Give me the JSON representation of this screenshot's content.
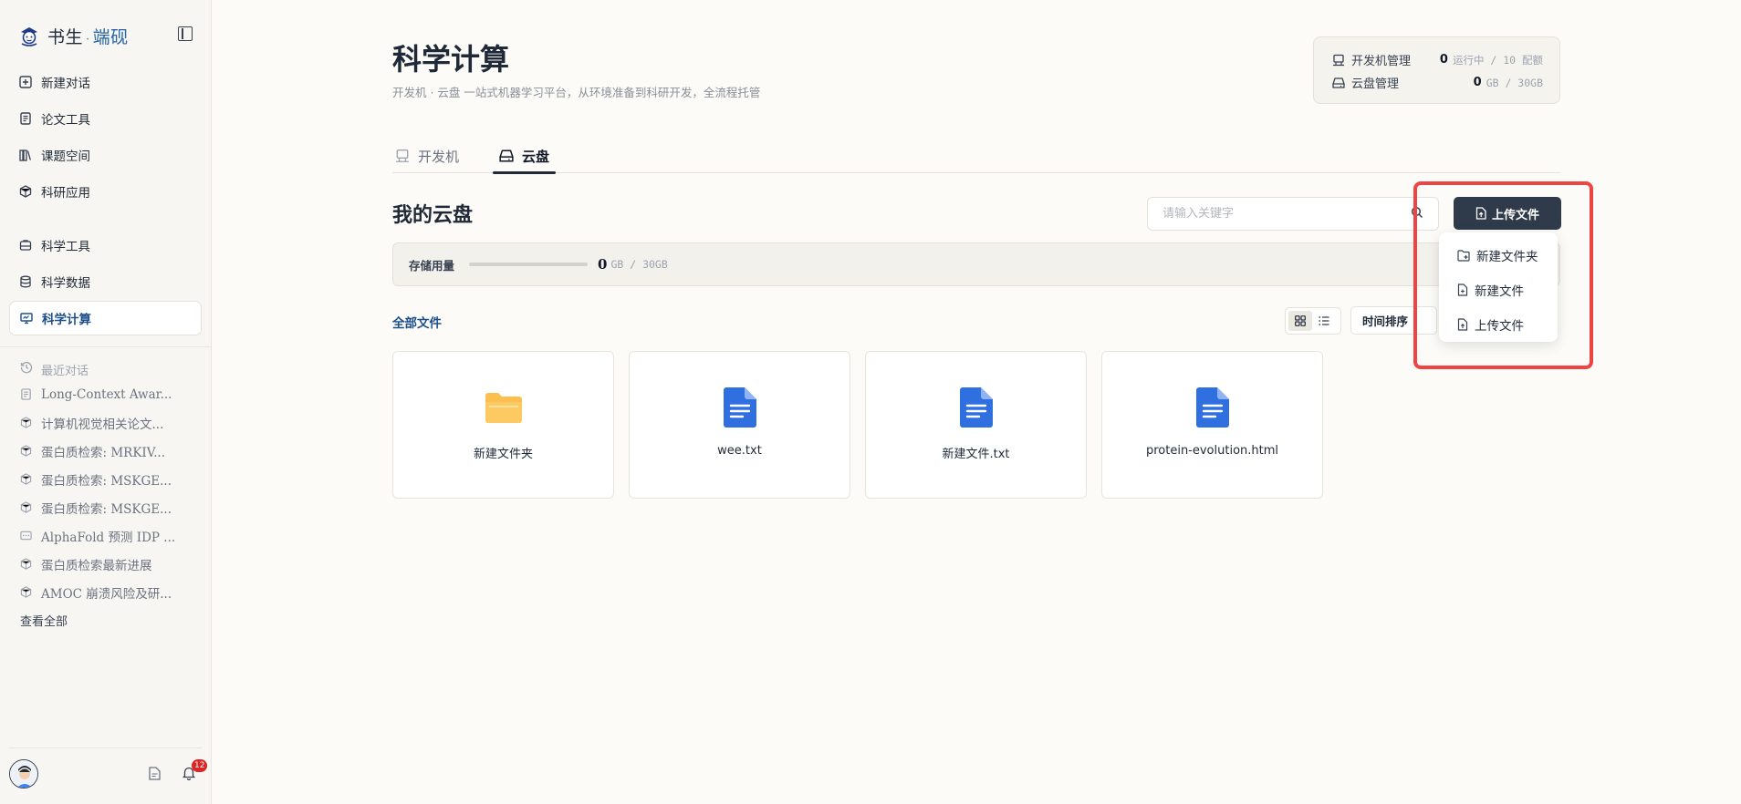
{
  "brand": {
    "name_main": "书生",
    "sep": "·",
    "name_accent": "端砚"
  },
  "sidebar": {
    "nav": [
      {
        "label": "新建对话",
        "icon": "plus-square-icon"
      },
      {
        "label": "论文工具",
        "icon": "document-icon"
      },
      {
        "label": "课题空间",
        "icon": "books-icon"
      },
      {
        "label": "科研应用",
        "icon": "cube-icon"
      }
    ],
    "nav2": [
      {
        "label": "科学工具",
        "icon": "toolbox-icon"
      },
      {
        "label": "科学数据",
        "icon": "database-icon"
      },
      {
        "label": "科学计算",
        "icon": "monitor-icon",
        "active": true
      }
    ],
    "recent_title": "最近对话",
    "recent": [
      {
        "label": "Long-Context Awar...",
        "icon": "document-icon"
      },
      {
        "label": "计算机视觉相关论文...",
        "icon": "cube-icon"
      },
      {
        "label": "蛋白质检索: MRKIV...",
        "icon": "cube-icon"
      },
      {
        "label": "蛋白质检索: MSKGE...",
        "icon": "cube-icon"
      },
      {
        "label": "蛋白质检索: MSKGE...",
        "icon": "cube-icon"
      },
      {
        "label": "AlphaFold 预测 IDP ...",
        "icon": "chat-icon"
      },
      {
        "label": "蛋白质检索最新进展",
        "icon": "cube-icon"
      },
      {
        "label": "AMOC 崩溃风险及研...",
        "icon": "cube-icon"
      }
    ],
    "view_all": "查看全部",
    "notification_count": "12"
  },
  "page": {
    "title": "科学计算",
    "subtitle": "开发机 · 云盘 一站式机器学习平台，从环境准备到科研开发，全流程托管"
  },
  "quota": {
    "dev": {
      "label": "开发机管理",
      "num": "0",
      "unit": "运行中 / 10 配额"
    },
    "disk": {
      "label": "云盘管理",
      "num": "0",
      "unit": "GB / 30GB"
    }
  },
  "tabs": [
    {
      "label": "开发机"
    },
    {
      "label": "云盘"
    }
  ],
  "drive": {
    "title": "我的云盘",
    "search_placeholder": "请输入关键字",
    "upload_label": "上传文件",
    "storage_label": "存储用量",
    "storage_used": "0",
    "storage_unit": "GB / 30GB",
    "storage_fraction": 0,
    "all_files": "全部文件",
    "sort_label": "时间排序",
    "files": [
      {
        "name": "新建文件夹",
        "type": "folder"
      },
      {
        "name": "wee.txt",
        "type": "file"
      },
      {
        "name": "新建文件.txt",
        "type": "file"
      },
      {
        "name": "protein-evolution.html",
        "type": "file"
      }
    ]
  },
  "dropdown": [
    {
      "label": "新建文件夹",
      "icon": "folder-plus-icon"
    },
    {
      "label": "新建文件",
      "icon": "file-plus-icon"
    },
    {
      "label": "上传文件",
      "icon": "file-upload-icon"
    }
  ],
  "colors": {
    "accent": "#1d4e89",
    "button_dark": "#2f3a4a",
    "folder": "#fbbf4f",
    "file": "#2f6fe0",
    "highlight": "#ef4444"
  }
}
